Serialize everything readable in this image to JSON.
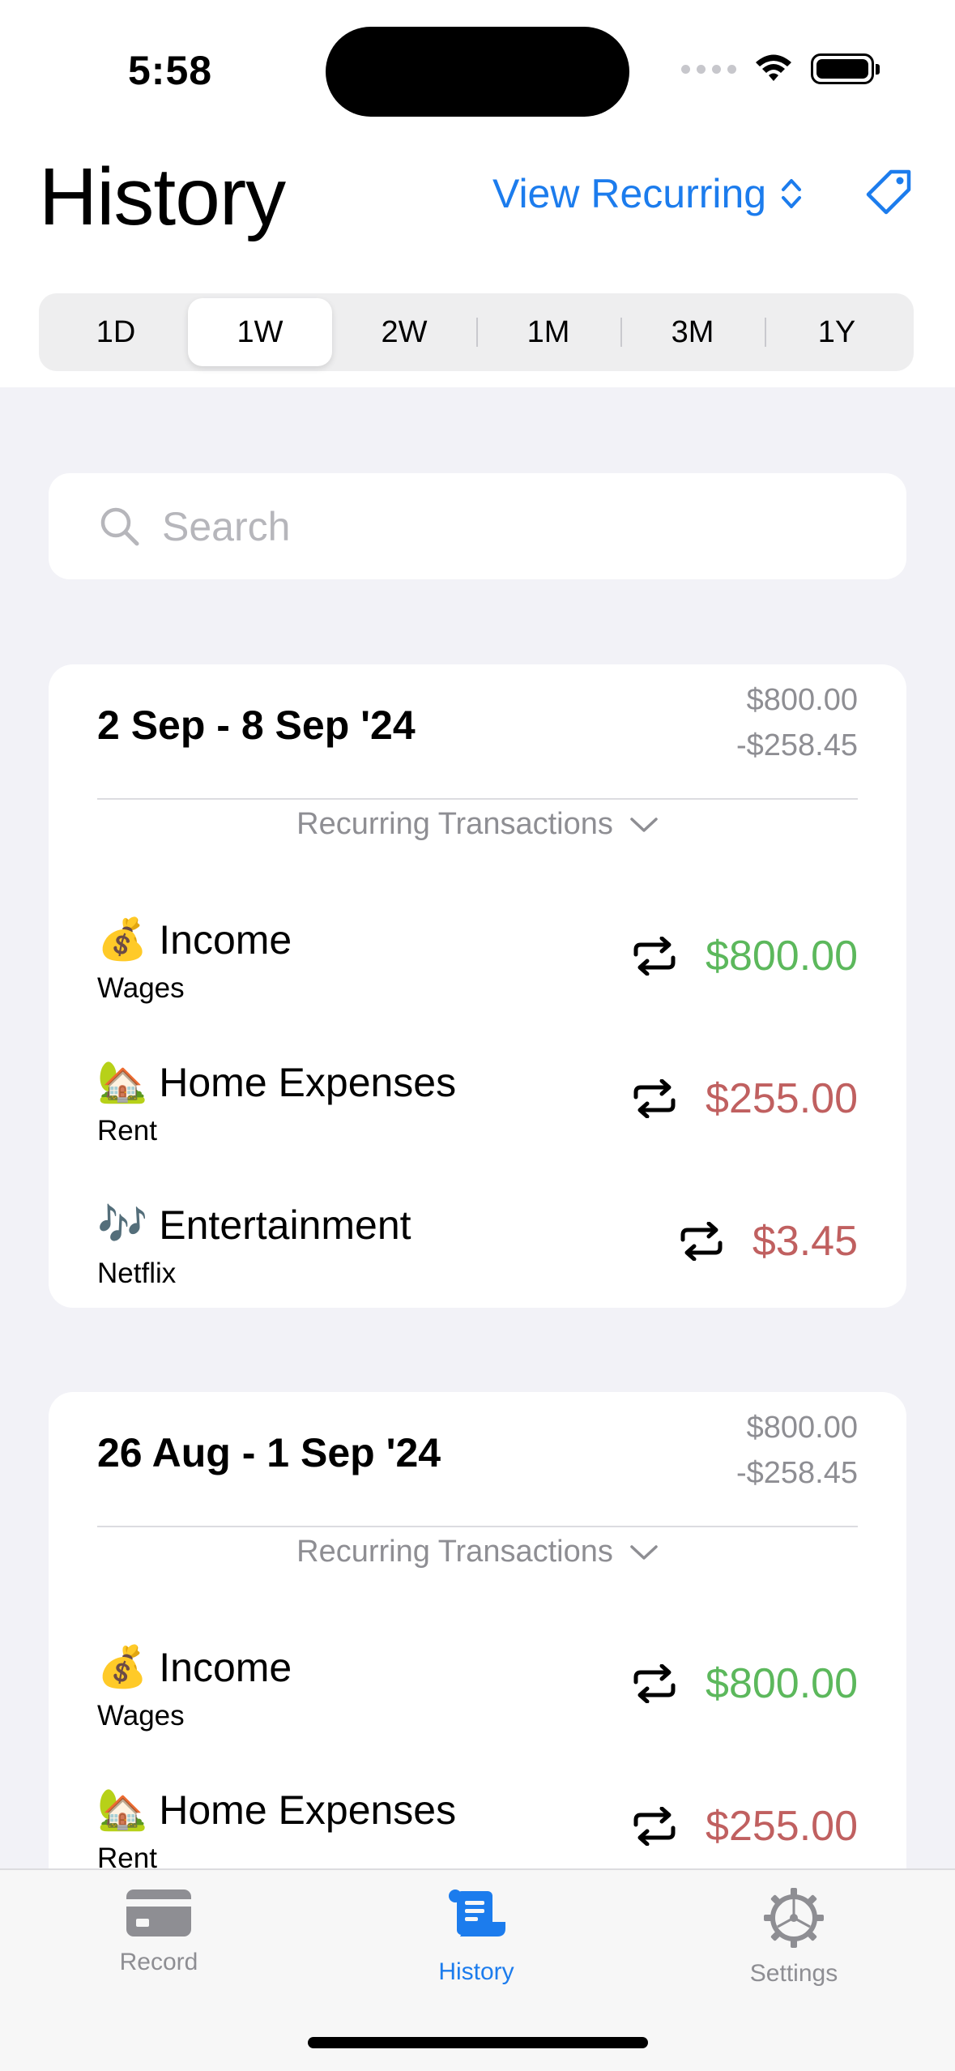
{
  "status": {
    "time": "5:58"
  },
  "header": {
    "title": "History",
    "view_recurring": "View Recurring"
  },
  "periods": [
    "1D",
    "1W",
    "2W",
    "1M",
    "3M",
    "1Y"
  ],
  "active_period": "1W",
  "search": {
    "placeholder": "Search"
  },
  "cards": [
    {
      "title": "2 Sep - 8 Sep '24",
      "income_total": "$800.00",
      "expense_total": "-$258.45",
      "recurring_label": "Recurring Transactions",
      "transactions": [
        {
          "emoji": "💰",
          "category": "Income",
          "note": "Wages",
          "amount": "$800.00",
          "type": "income"
        },
        {
          "emoji": "🏡",
          "category": "Home Expenses",
          "note": "Rent",
          "amount": "$255.00",
          "type": "expense"
        },
        {
          "emoji": "🎶",
          "category": "Entertainment",
          "note": "Netflix",
          "amount": "$3.45",
          "type": "expense"
        }
      ]
    },
    {
      "title": "26 Aug - 1 Sep '24",
      "income_total": "$800.00",
      "expense_total": "-$258.45",
      "recurring_label": "Recurring Transactions",
      "transactions": [
        {
          "emoji": "💰",
          "category": "Income",
          "note": "Wages",
          "amount": "$800.00",
          "type": "income"
        },
        {
          "emoji": "🏡",
          "category": "Home Expenses",
          "note": "Rent",
          "amount": "$255.00",
          "type": "expense"
        }
      ]
    }
  ],
  "tabs": [
    {
      "label": "Record",
      "icon": "card-icon"
    },
    {
      "label": "History",
      "icon": "scroll-icon"
    },
    {
      "label": "Settings",
      "icon": "gear-icon"
    }
  ],
  "active_tab": "History",
  "colors": {
    "accent": "#1C7CED",
    "income": "#5CB85C",
    "expense": "#C06060"
  }
}
